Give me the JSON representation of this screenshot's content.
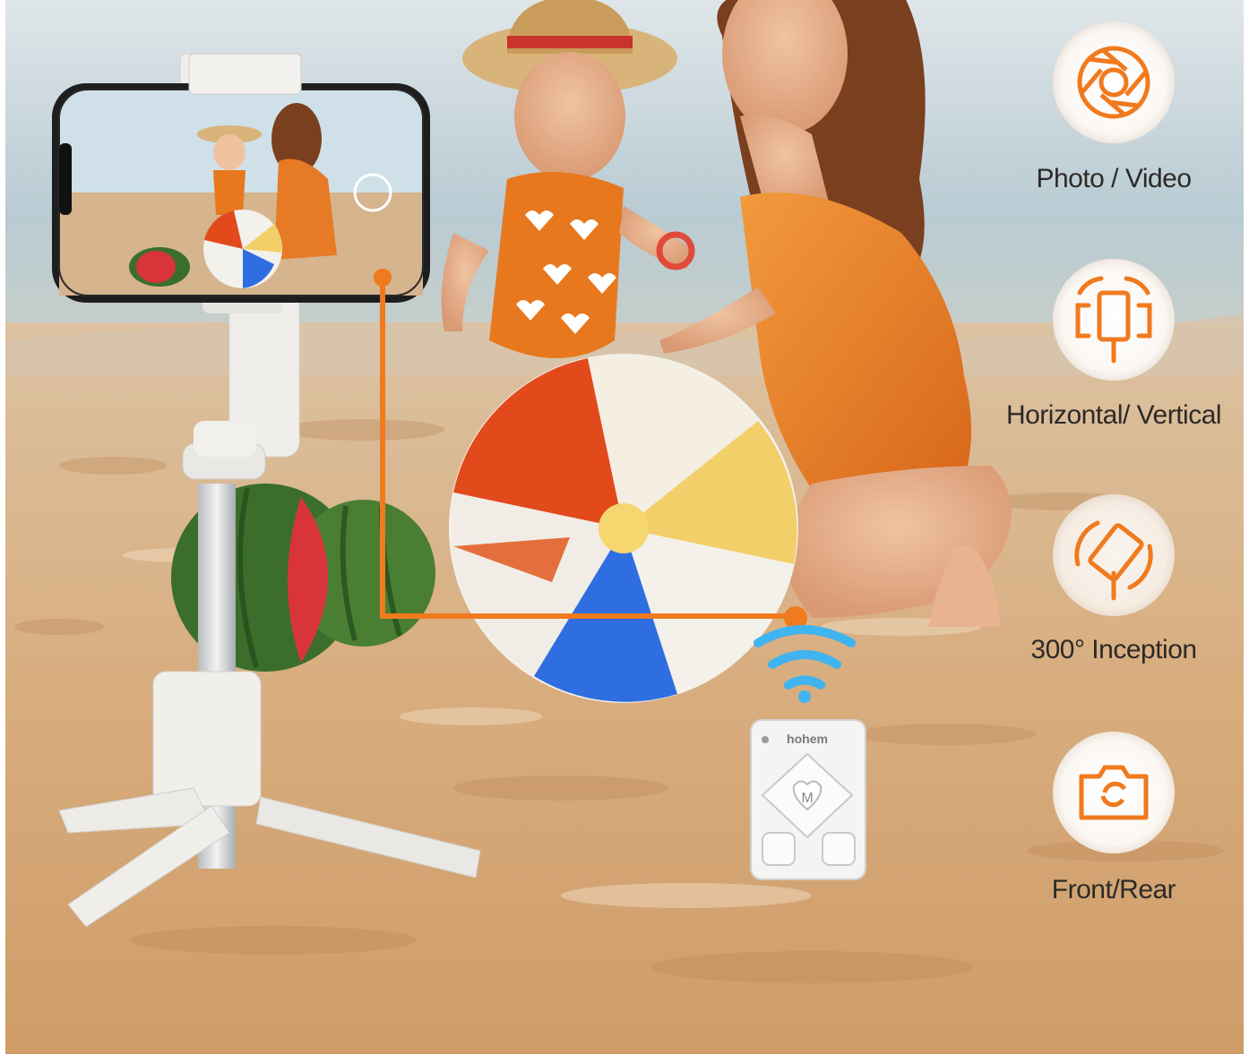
{
  "features": [
    {
      "label": "Photo / Video",
      "icon": "shutter-icon"
    },
    {
      "label": "Horizontal/ Vertical",
      "icon": "rotate-phone-icon"
    },
    {
      "label": "300° Inception",
      "icon": "inception-rotate-icon"
    },
    {
      "label": "Front/Rear",
      "icon": "camera-switch-icon"
    }
  ],
  "remote": {
    "brand": "hohem",
    "center_button": "M"
  },
  "colors": {
    "accent": "#f07a1e",
    "wifi": "#3fb4f0",
    "sand": "#d9b48a",
    "sea": "#c9d7dc",
    "device": "#eeeeec"
  }
}
